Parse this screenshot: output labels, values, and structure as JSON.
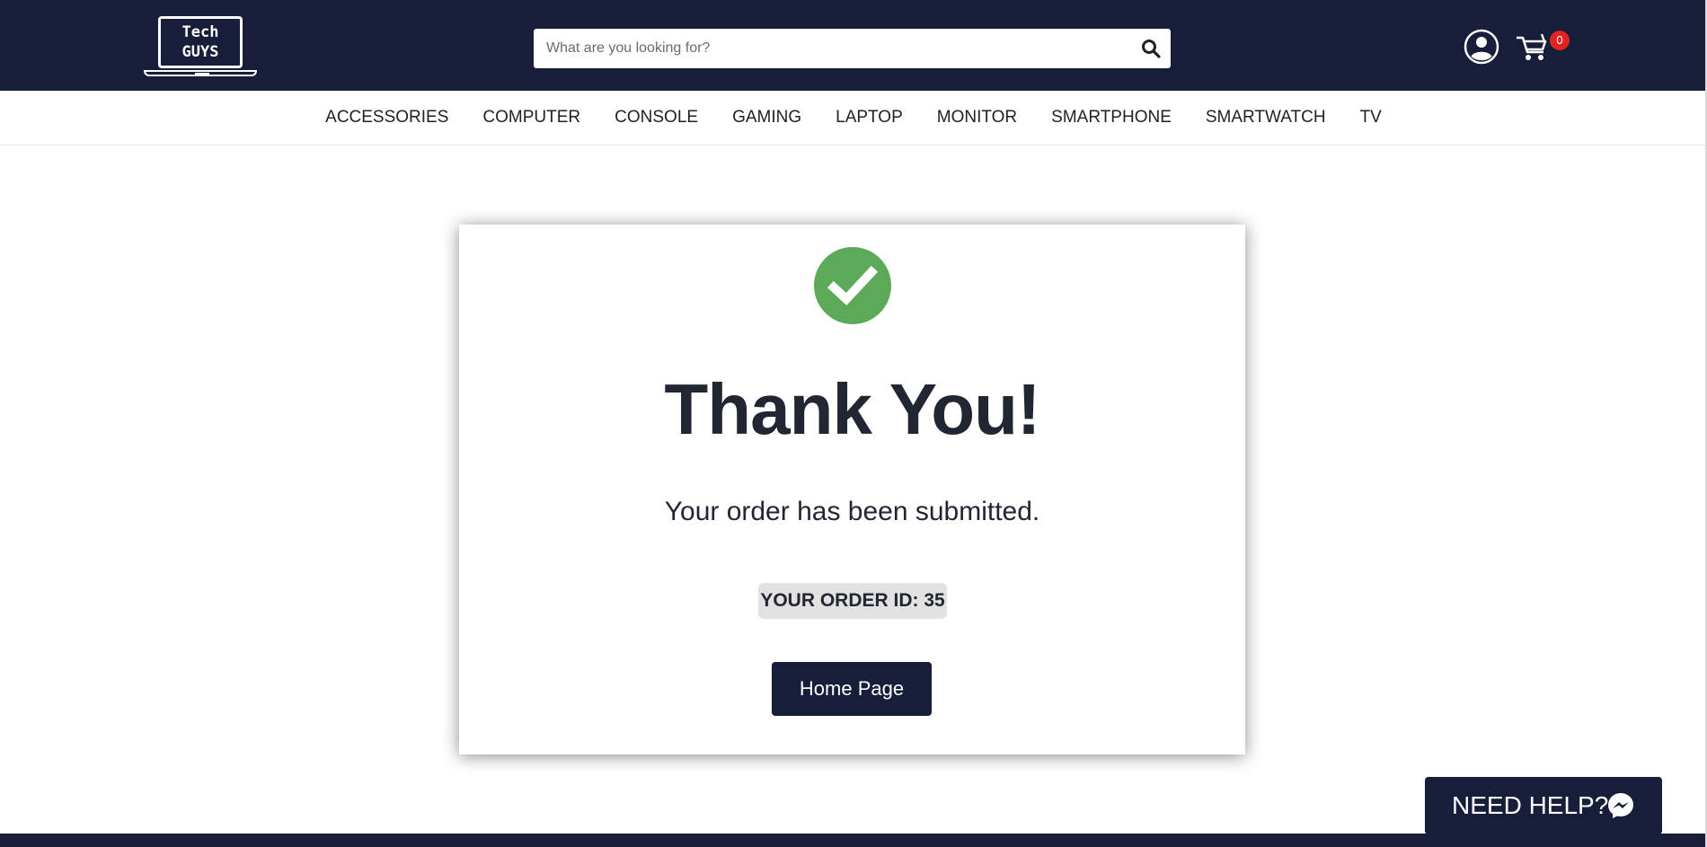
{
  "header": {
    "logo_line1": "Tech",
    "logo_line2": "GUYS",
    "search_placeholder": "What are you looking for?",
    "cart_count": "0"
  },
  "categories": [
    "ACCESSORIES",
    "COMPUTER",
    "CONSOLE",
    "GAMING",
    "LAPTOP",
    "MONITOR",
    "SMARTPHONE",
    "SMARTWATCH",
    "TV"
  ],
  "confirmation": {
    "title": "Thank You!",
    "message": "Your order has been submitted.",
    "order_id": "YOUR ORDER ID: 35",
    "home_button": "Home Page"
  },
  "help": {
    "label": "NEED HELP?"
  },
  "colors": {
    "navy": "#161e3a",
    "success_green": "#5ca957",
    "badge_red": "#e02424"
  }
}
